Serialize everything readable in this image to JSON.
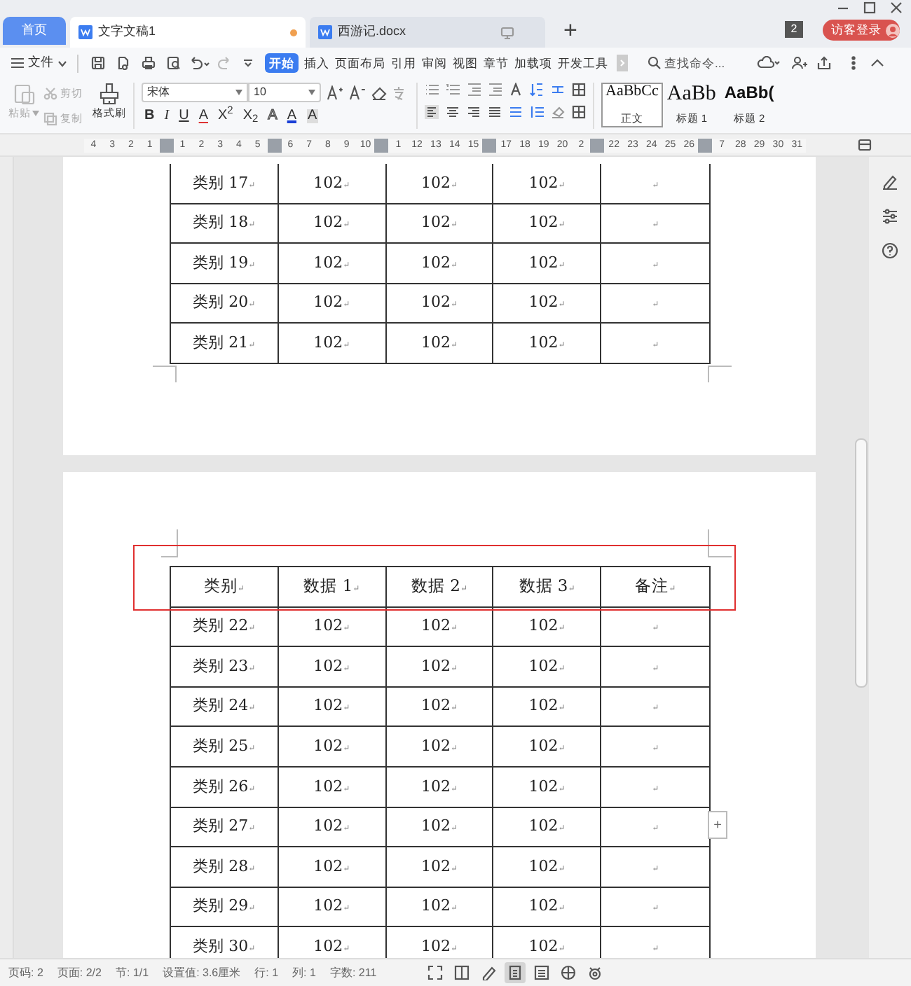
{
  "tabs": [
    {
      "kind": "home",
      "label": "首页",
      "selected": false
    },
    {
      "kind": "doc",
      "label": "文字文稿1",
      "selected": true,
      "modified": true
    },
    {
      "kind": "doc",
      "label": "西游记.docx",
      "selected": false,
      "modified": false
    }
  ],
  "new_tab": "+",
  "notification_count": "2",
  "login_button": "访客登录",
  "menu": {
    "file": "文件",
    "items": [
      {
        "label": "开始",
        "selected": true
      },
      {
        "label": "插入",
        "selected": false
      },
      {
        "label": "页面布局",
        "selected": false
      },
      {
        "label": "引用",
        "selected": false
      },
      {
        "label": "审阅",
        "selected": false
      },
      {
        "label": "视图",
        "selected": false
      },
      {
        "label": "章节",
        "selected": false
      },
      {
        "label": "加载项",
        "selected": false
      },
      {
        "label": "开发工具",
        "selected": false
      }
    ],
    "search_placeholder": "查找命令..."
  },
  "ribbon": {
    "paste": {
      "label": "粘贴",
      "disabled": true
    },
    "cut": {
      "label": "剪切",
      "disabled": true
    },
    "copy": {
      "label": "复制",
      "disabled": true
    },
    "format_painter": {
      "label": "格式刷",
      "disabled": false
    },
    "font": "宋体",
    "size": "10",
    "format_buttons": [
      {
        "label": "B",
        "kind": "bold"
      },
      {
        "label": "I",
        "kind": "italic"
      },
      {
        "label": "U",
        "kind": "underline"
      },
      {
        "label": "A",
        "kind": "strike"
      },
      {
        "label": "X$^{2}$",
        "kind": "plain"
      },
      {
        "label": "X$_{2}$",
        "kind": "plain"
      },
      {
        "label": "A",
        "kind": "outline"
      },
      {
        "label": "A",
        "kind": "color"
      },
      {
        "label": "A",
        "kind": "shade"
      }
    ],
    "styles": [
      {
        "sample": "AaBbCc",
        "label": "正文",
        "kind": "normal",
        "selected": true
      },
      {
        "sample": "AaBb",
        "label": "标题 1",
        "kind": "heading1",
        "selected": false
      },
      {
        "sample": "AaBb(",
        "label": "标题 2",
        "kind": "heading2",
        "selected": false
      }
    ]
  },
  "ruler": [
    {
      "kind": "number",
      "label": "4"
    },
    {
      "kind": "number",
      "label": "3"
    },
    {
      "kind": "number",
      "label": "2"
    },
    {
      "kind": "number",
      "label": "1"
    },
    {
      "kind": "marker"
    },
    {
      "kind": "number",
      "label": "1"
    },
    {
      "kind": "number",
      "label": "2"
    },
    {
      "kind": "number",
      "label": "3"
    },
    {
      "kind": "number",
      "label": "4"
    },
    {
      "kind": "number",
      "label": "5"
    },
    {
      "kind": "marker"
    },
    {
      "kind": "number",
      "label": "6"
    },
    {
      "kind": "number",
      "label": "7"
    },
    {
      "kind": "number",
      "label": "8"
    },
    {
      "kind": "number",
      "label": "9"
    },
    {
      "kind": "number",
      "label": "10"
    },
    {
      "kind": "marker"
    },
    {
      "kind": "number",
      "label": "1"
    },
    {
      "kind": "number",
      "label": "12"
    },
    {
      "kind": "number",
      "label": "13"
    },
    {
      "kind": "number",
      "label": "14"
    },
    {
      "kind": "number",
      "label": "15"
    },
    {
      "kind": "marker"
    },
    {
      "kind": "number",
      "label": "17"
    },
    {
      "kind": "number",
      "label": "18"
    },
    {
      "kind": "number",
      "label": "19"
    },
    {
      "kind": "number",
      "label": "20"
    },
    {
      "kind": "number",
      "label": "2"
    },
    {
      "kind": "marker"
    },
    {
      "kind": "number",
      "label": "22"
    },
    {
      "kind": "number",
      "label": "23"
    },
    {
      "kind": "number",
      "label": "24"
    },
    {
      "kind": "number",
      "label": "25"
    },
    {
      "kind": "number",
      "label": "26"
    },
    {
      "kind": "marker"
    },
    {
      "kind": "number",
      "label": "7"
    },
    {
      "kind": "number",
      "label": "28"
    },
    {
      "kind": "number",
      "label": "29"
    },
    {
      "kind": "number",
      "label": "30"
    },
    {
      "kind": "number",
      "label": "31"
    }
  ],
  "paragraph_mark": "↵",
  "pages": [
    {
      "rows": [
        [
          "类别 17",
          "102",
          "102",
          "102"
        ],
        [
          "类别 18",
          "102",
          "102",
          "102"
        ],
        [
          "类别 19",
          "102",
          "102",
          "102"
        ],
        [
          "类别 20",
          "102",
          "102",
          "102"
        ],
        [
          "类别 21",
          "102",
          "102",
          "102"
        ]
      ]
    },
    {
      "header": [
        "类别",
        "数据 1",
        "数据 2",
        "数据 3",
        "备注"
      ],
      "header_highlighted": true,
      "add_row_button": "+",
      "rows": [
        [
          "类别 22",
          "102",
          "102",
          "102"
        ],
        [
          "类别 23",
          "102",
          "102",
          "102"
        ],
        [
          "类别 24",
          "102",
          "102",
          "102"
        ],
        [
          "类别 25",
          "102",
          "102",
          "102"
        ],
        [
          "类别 26",
          "102",
          "102",
          "102"
        ],
        [
          "类别 27",
          "102",
          "102",
          "102"
        ],
        [
          "类别 28",
          "102",
          "102",
          "102"
        ],
        [
          "类别 29",
          "102",
          "102",
          "102"
        ],
        [
          "类别 30",
          "102",
          "102",
          "102"
        ]
      ]
    }
  ],
  "status_bar": [
    "页码: 2",
    "页面: 2/2",
    "节: 1/1",
    "设置值: 3.6厘米",
    "行: 1",
    "列: 1",
    "字数: 211"
  ],
  "views": [
    {
      "kind": "fullscreen",
      "selected": false
    },
    {
      "kind": "read",
      "selected": false
    },
    {
      "kind": "edit",
      "selected": false
    },
    {
      "kind": "page",
      "selected": true
    },
    {
      "kind": "outline",
      "selected": false
    },
    {
      "kind": "web",
      "selected": false
    },
    {
      "kind": "eye",
      "selected": false
    }
  ]
}
